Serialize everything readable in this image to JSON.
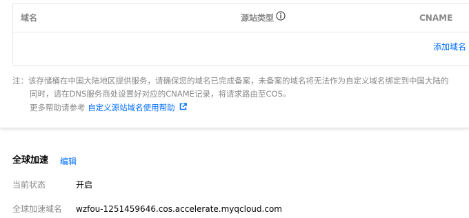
{
  "domain_table": {
    "columns": {
      "domain": "域名",
      "origin_type": "源站类型",
      "cname": "CNAME"
    },
    "add_domain_label": "添加域名"
  },
  "notes": {
    "line1": "注：该存储桶在中国大陆地区提供服务，请确保您的域名已完成备案，未备案的域名将无法作为自定义域名绑定到中国大陆的",
    "line2": "同时，请在DNS服务商处设置好对应的CNAME记录，将请求路由至COS。",
    "help_prefix": "更多帮助请参考",
    "help_link": "自定义源站域名使用帮助"
  },
  "global_acceleration": {
    "title": "全球加速",
    "edit_label": "编辑",
    "status_label": "当前状态",
    "status_value": "开启",
    "domain_label": "全球加速域名",
    "domain_value": "wzfou-1251459646.cos.accelerate.myqcloud.com"
  },
  "colors": {
    "link": "#006eff",
    "muted_text": "#888888",
    "border": "#e5e5e5"
  },
  "icons": {
    "origin_type_info": "info-icon",
    "help_link_external": "external-link-icon"
  }
}
